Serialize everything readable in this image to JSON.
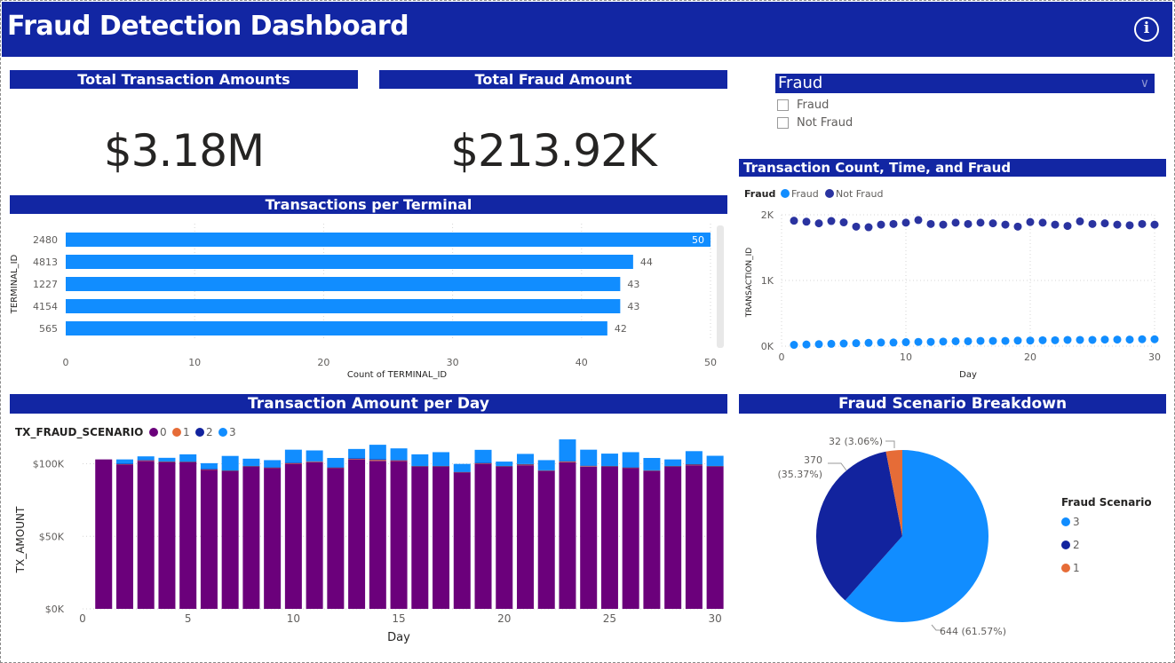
{
  "header": {
    "title": "Fraud Detection Dashboard",
    "info_icon": "info-icon"
  },
  "kpis": {
    "total_transactions": {
      "title": "Total Transaction Amounts",
      "value": "$3.18M"
    },
    "total_fraud": {
      "title": "Total Fraud Amount",
      "value": "$213.92K"
    }
  },
  "slicer": {
    "title": "Fraud",
    "chevron_icon": "chevron-down-icon",
    "options": [
      {
        "label": "Fraud",
        "checked": false
      },
      {
        "label": "Not Fraud",
        "checked": false
      }
    ]
  },
  "chart_data": [
    {
      "id": "terminal",
      "type": "bar",
      "orientation": "horizontal",
      "title": "Transactions per Terminal",
      "xlabel": "Count of TERMINAL_ID",
      "ylabel": "TERMINAL_ID",
      "categories": [
        "2480",
        "4813",
        "1227",
        "4154",
        "565"
      ],
      "values": [
        50,
        44,
        43,
        43,
        42
      ],
      "xlim": [
        0,
        50
      ],
      "x_ticks": [
        "0",
        "10",
        "20",
        "30",
        "40",
        "50"
      ],
      "grid": true,
      "color": "#118dff"
    },
    {
      "id": "scatter",
      "type": "scatter",
      "title": "Transaction Count, Time, and Fraud",
      "xlabel": "Day",
      "ylabel": "TRANSACTION_ID",
      "legend_title": "Fraud",
      "legend_position": "top-left",
      "xlim": [
        0,
        30
      ],
      "ylim": [
        0,
        2000
      ],
      "x_ticks": [
        "0",
        "10",
        "20",
        "30"
      ],
      "y_ticks": [
        "0K",
        "1K",
        "2K"
      ],
      "grid": true,
      "series": [
        {
          "name": "Fraud",
          "color": "#118dff",
          "x": [
            1,
            2,
            3,
            4,
            5,
            6,
            7,
            8,
            9,
            10,
            11,
            12,
            13,
            14,
            15,
            16,
            17,
            18,
            19,
            20,
            21,
            22,
            23,
            24,
            25,
            26,
            27,
            28,
            29,
            30
          ],
          "y": [
            20,
            25,
            30,
            35,
            40,
            45,
            50,
            55,
            55,
            60,
            65,
            65,
            70,
            75,
            75,
            80,
            80,
            80,
            85,
            85,
            90,
            90,
            95,
            95,
            95,
            100,
            100,
            100,
            105,
            105
          ]
        },
        {
          "name": "Not Fraud",
          "color": "#2a33a0",
          "x": [
            1,
            2,
            3,
            4,
            5,
            6,
            7,
            8,
            9,
            10,
            11,
            12,
            13,
            14,
            15,
            16,
            17,
            18,
            19,
            20,
            21,
            22,
            23,
            24,
            25,
            26,
            27,
            28,
            29,
            30
          ],
          "y": [
            1910,
            1895,
            1870,
            1905,
            1885,
            1820,
            1810,
            1850,
            1860,
            1880,
            1920,
            1860,
            1850,
            1880,
            1860,
            1880,
            1870,
            1850,
            1820,
            1890,
            1880,
            1850,
            1830,
            1900,
            1860,
            1870,
            1850,
            1840,
            1860,
            1850
          ]
        }
      ]
    },
    {
      "id": "amount",
      "type": "bar",
      "stacked": true,
      "title": "Transaction Amount per Day",
      "xlabel": "Day",
      "ylabel": "TX_AMOUNT",
      "legend_title": "TX_FRAUD_SCENARIO",
      "legend_position": "top-left",
      "ylim": [
        0,
        115000
      ],
      "y_ticks": [
        "$0K",
        "$50K",
        "$100K"
      ],
      "x_ticks": [
        "0",
        "5",
        "10",
        "15",
        "20",
        "25",
        "30"
      ],
      "xlim": [
        0,
        30.5
      ],
      "grid": true,
      "categories": [
        1,
        2,
        3,
        4,
        5,
        6,
        7,
        8,
        9,
        10,
        11,
        12,
        13,
        14,
        15,
        16,
        17,
        18,
        19,
        20,
        21,
        22,
        23,
        24,
        25,
        26,
        27,
        28,
        29,
        30
      ],
      "series": [
        {
          "name": "0",
          "color": "#6b007b",
          "values": [
            103000,
            99500,
            102000,
            101000,
            101000,
            96000,
            95000,
            98000,
            97000,
            100000,
            101000,
            97000,
            103000,
            102000,
            102000,
            98000,
            98000,
            94000,
            100000,
            98000,
            99000,
            95000,
            101000,
            98000,
            98000,
            97000,
            95000,
            98000,
            99000,
            98000
          ]
        },
        {
          "name": "1",
          "color": "#e66c37",
          "values": [
            0,
            300,
            400,
            300,
            300,
            200,
            200,
            300,
            300,
            400,
            400,
            300,
            400,
            600,
            300,
            300,
            300,
            200,
            300,
            300,
            400,
            300,
            500,
            400,
            300,
            300,
            300,
            300,
            400,
            300
          ]
        },
        {
          "name": "2",
          "color": "#12239e",
          "values": [
            0,
            200,
            200,
            300,
            200,
            200,
            200,
            200,
            200,
            300,
            300,
            200,
            300,
            500,
            300,
            200,
            200,
            200,
            300,
            200,
            400,
            200,
            300,
            300,
            200,
            200,
            200,
            200,
            300,
            200
          ]
        },
        {
          "name": "3",
          "color": "#118dff",
          "values": [
            0,
            3000,
            2500,
            2500,
            5000,
            4000,
            10000,
            5000,
            5000,
            9000,
            7500,
            6500,
            6500,
            10000,
            8000,
            8000,
            9500,
            5500,
            9000,
            3000,
            7000,
            7000,
            15000,
            11000,
            8500,
            10500,
            8500,
            4500,
            9000,
            7000
          ]
        }
      ]
    },
    {
      "id": "pie",
      "type": "pie",
      "title": "Fraud Scenario Breakdown",
      "legend_title": "Fraud Scenario",
      "legend_position": "right",
      "slices": [
        {
          "name": "3",
          "value": 644,
          "label": "644 (61.57%)",
          "color": "#118dff"
        },
        {
          "name": "2",
          "value": 370,
          "label": "370 (35.37%)",
          "label_line1": "370",
          "label_line2": "(35.37%)",
          "color": "#12239e"
        },
        {
          "name": "1",
          "value": 32,
          "label": "32 (3.06%)",
          "color": "#e66c37"
        }
      ]
    }
  ]
}
